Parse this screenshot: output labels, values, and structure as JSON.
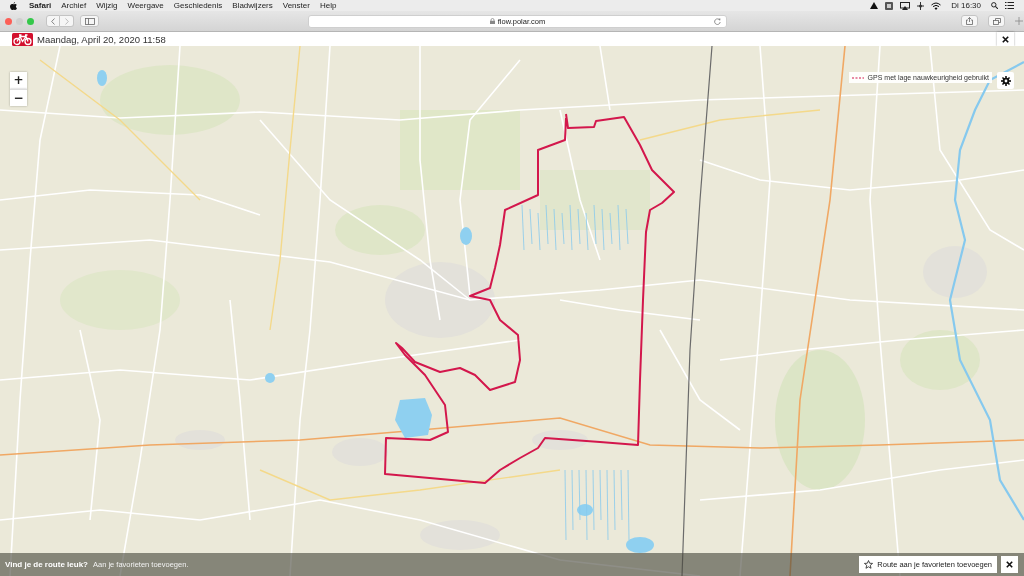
{
  "menu_bar": {
    "app_name": "Safari",
    "menus": [
      "Archief",
      "Wijzig",
      "Weergave",
      "Geschiedenis",
      "Bladwijzers",
      "Venster",
      "Help"
    ],
    "clock": "Di 16:30"
  },
  "browser": {
    "address": "flow.polar.com"
  },
  "page_header": {
    "title": "Maandag, April 20, 2020 11:58"
  },
  "map": {
    "zoom_in": "+",
    "zoom_out": "−",
    "legend": "GPS met lage nauwkeurigheid gebruikt"
  },
  "favorite_bar": {
    "question": "Vind je de route leuk?",
    "prompt": "Aan je favorieten toevoegen.",
    "button": "Route aan je favorieten toevoegen"
  }
}
